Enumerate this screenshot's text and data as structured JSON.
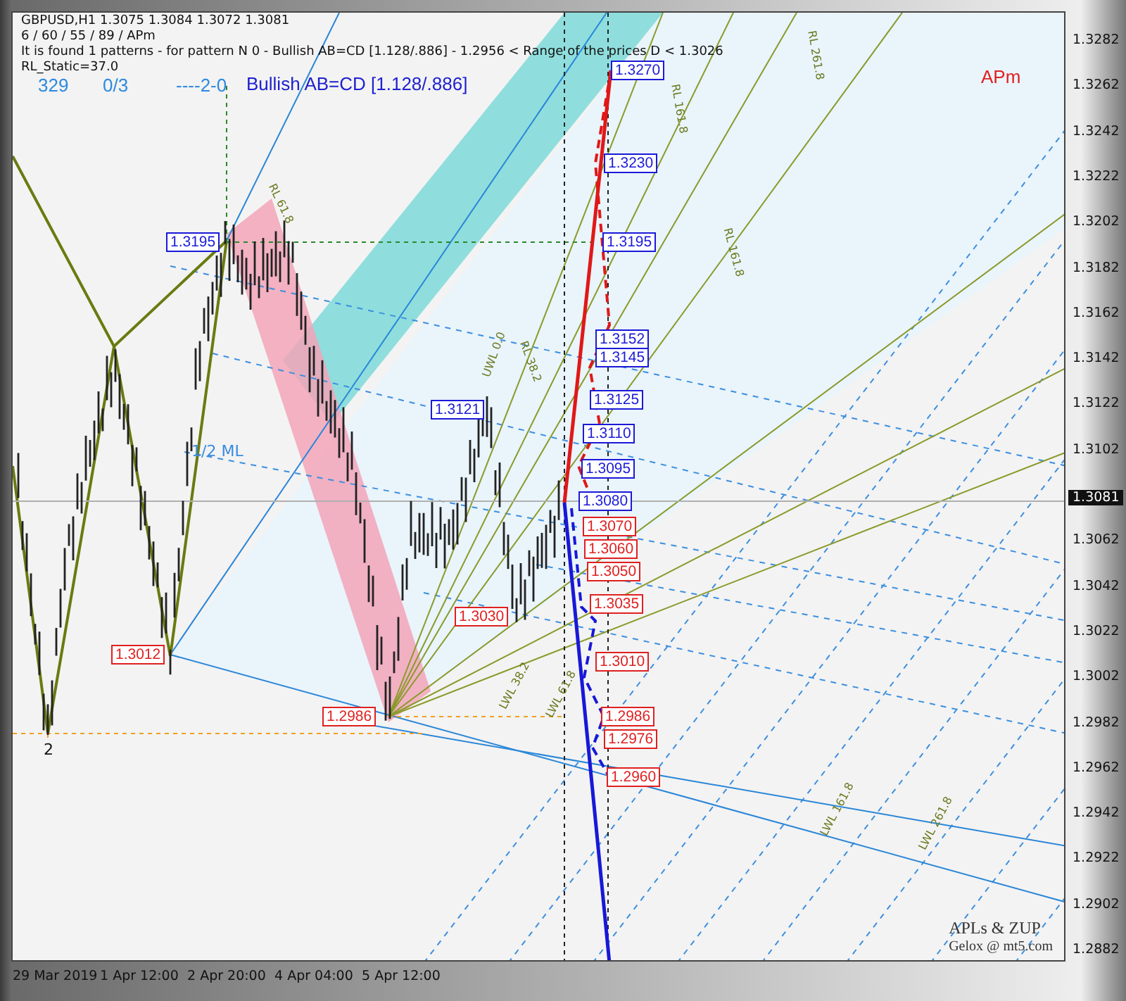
{
  "chart_header": {
    "symbol_line": "GBPUSD,H1  1.3075 1.3084 1.3072 1.3081",
    "params_line": "6 / 60 / 55 / 89 / APm",
    "message": "It is found 1 patterns  -  for pattern N 0 - Bullish AB=CD [1.128/.886] - 1.2956 < Range of the prices D < 1.3026",
    "rl_static": "RL_Static=37.0"
  },
  "counters": [
    "329",
    "0/3",
    "----2-0"
  ],
  "pattern_title": "Bullish AB=CD [1.128/.886]",
  "indicator_tag": "APm",
  "annotations": [
    "1/2 ML",
    "2"
  ],
  "line_labels": [
    "RL 61.8",
    "RL 38.2",
    "UWL 0.0",
    "RL 161.8",
    "RL 261.8",
    "RL 161.8",
    "LWL 38.2",
    "LWL 61.8",
    "LWL 161.8",
    "LWL 261.8"
  ],
  "price_labels": [
    {
      "text": "1.3270",
      "color": "#1a1ad8"
    },
    {
      "text": "1.3230",
      "color": "#1a1ad8"
    },
    {
      "text": "1.3195",
      "color": "#1a1ad8"
    },
    {
      "text": "1.3152",
      "color": "#1a1ad8"
    },
    {
      "text": "1.3145",
      "color": "#1a1ad8"
    },
    {
      "text": "1.3125",
      "color": "#1a1ad8"
    },
    {
      "text": "1.3110",
      "color": "#1a1ad8"
    },
    {
      "text": "1.3095",
      "color": "#1a1ad8"
    },
    {
      "text": "1.3080",
      "color": "#1a1ad8"
    },
    {
      "text": "1.3195",
      "color": "#1a1ad8"
    },
    {
      "text": "1.3121",
      "color": "#1a1ad8"
    },
    {
      "text": "1.3070",
      "color": "#e02020"
    },
    {
      "text": "1.3060",
      "color": "#e02020"
    },
    {
      "text": "1.3050",
      "color": "#e02020"
    },
    {
      "text": "1.3035",
      "color": "#e02020"
    },
    {
      "text": "1.3010",
      "color": "#e02020"
    },
    {
      "text": "1.2986",
      "color": "#e02020"
    },
    {
      "text": "1.2976",
      "color": "#e02020"
    },
    {
      "text": "1.2960",
      "color": "#e02020"
    },
    {
      "text": "1.3012",
      "color": "#e02020"
    },
    {
      "text": "1.3030",
      "color": "#e02020"
    },
    {
      "text": "1.2986",
      "color": "#e02020"
    }
  ],
  "price_axis": {
    "ticks": [
      "1.3282",
      "1.3262",
      "1.3242",
      "1.3222",
      "1.3202",
      "1.3182",
      "1.3162",
      "1.3142",
      "1.3122",
      "1.3102",
      "1.3062",
      "1.3042",
      "1.3022",
      "1.3002",
      "1.2982",
      "1.2962",
      "1.2942",
      "1.2922",
      "1.2902",
      "1.2882"
    ],
    "current_price": "1.3081"
  },
  "time_axis": {
    "labels": [
      "29 Mar 2019",
      "1 Apr 12:00",
      "2 Apr 20:00",
      "4 Apr 04:00",
      "5 Apr 12:00"
    ]
  },
  "signature": {
    "title": "APLs & ZUP",
    "credit": "Gelox @ mt5.com"
  }
}
